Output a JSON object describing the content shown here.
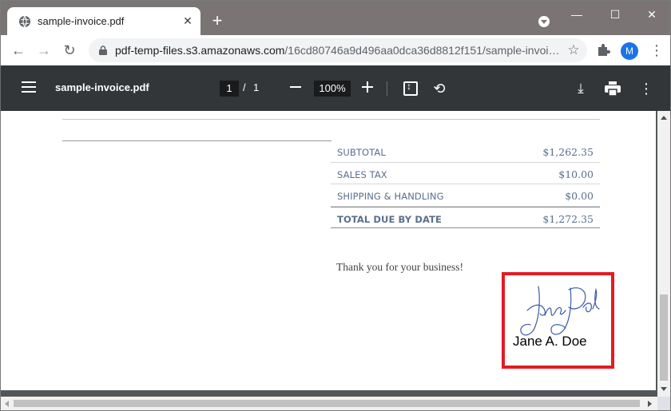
{
  "browser": {
    "tab_title": "sample-invoice.pdf",
    "tab_close": "✕",
    "new_tab": "+",
    "window_controls": {
      "minimize": "—",
      "maximize": "☐",
      "close": "✕"
    },
    "url_domain": "pdf-temp-files.s3.amazonaws.com",
    "url_path": "/16cd80746a9d496aa0dca36d8812f151/sample-invoi…",
    "back": "←",
    "forward": "→",
    "reload": "↻",
    "bookmark_star": "☆",
    "profile_initial": "M",
    "menu": "⋮"
  },
  "pdf_toolbar": {
    "title": "sample-invoice.pdf",
    "current_page": "1",
    "page_separator": "/",
    "total_pages": "1",
    "zoom": "100%",
    "rotate": "⟲",
    "download": "⤓",
    "more": "⋮"
  },
  "invoice": {
    "totals": [
      {
        "label": "SUBTOTAL",
        "value": "$1,262.35"
      },
      {
        "label": "SALES TAX",
        "value": "$10.00"
      },
      {
        "label": "SHIPPING & HANDLING",
        "value": "$0.00"
      },
      {
        "label": "TOTAL DUE BY DATE",
        "value": "$1,272.35"
      }
    ],
    "thanks": "Thank you for your business!",
    "signature_name": "Jane A. Doe"
  },
  "colors": {
    "highlight_box": "#e31b23",
    "signature_ink": "#3b5ba9",
    "totals_text": "#5a6f8c"
  }
}
